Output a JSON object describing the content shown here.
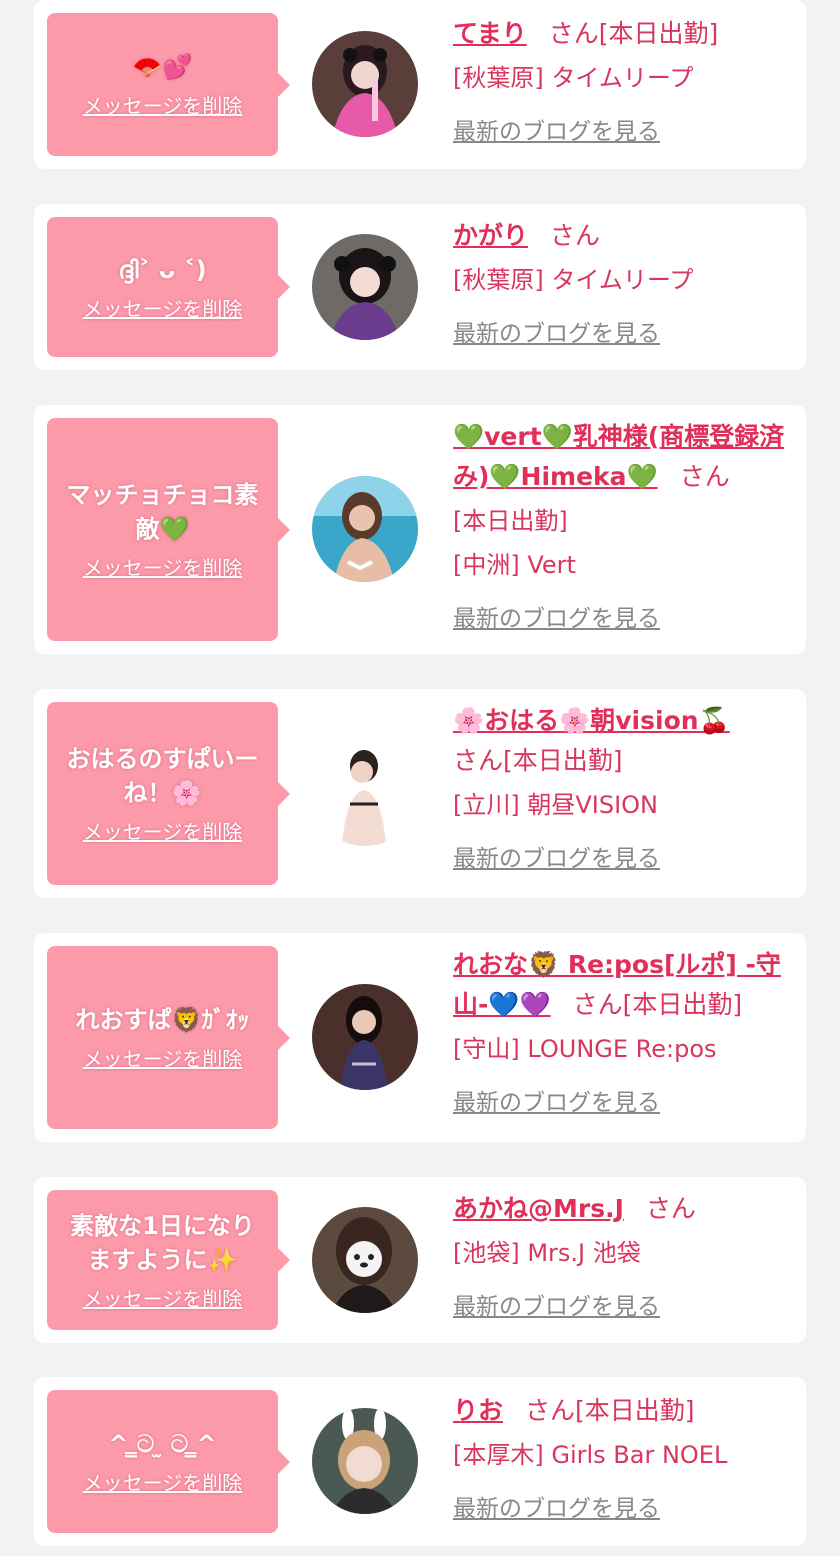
{
  "colors": {
    "background": "#f2f2f2",
    "card": "#ffffff",
    "bubble": "#fd9aaa",
    "accent": "#e0305a",
    "muted": "#888888"
  },
  "common": {
    "delete_label": "メッセージを削除",
    "san_label": "さん",
    "blog_label": "最新のブログを見る"
  },
  "cards": [
    {
      "message": "🪭💕",
      "name": "てまり",
      "on_duty": "[本日出勤]",
      "shop": "[秋葉原] タイムリープ"
    },
    {
      "message": "ദ്ദി˃ ᴗ ˂)",
      "name": "かがり",
      "on_duty": "",
      "shop": "[秋葉原] タイムリープ"
    },
    {
      "message": "マッチョチョコ素敵💚",
      "name": "💚vert💚乳神様(商標登録済み)💚Himeka💚",
      "on_duty": "[本日出勤]",
      "shop": "[中洲] Vert"
    },
    {
      "message": "おはるのすぱいーね！🌸",
      "name": "🌸おはる🌸朝vision🍒",
      "on_duty": "[本日出勤]",
      "shop": "[立川] 朝昼VISION"
    },
    {
      "message": "れおすぱ🦁ｶﾞｵｯ",
      "name": "れおな🦁 Re:pos[ルポ] -守山-💙💜",
      "on_duty": "[本日出勤]",
      "shop": "[守山] LOUNGE Re:pos"
    },
    {
      "message": "素敵な1日になりますように✨",
      "name": "あかね@Mrs.J",
      "on_duty": "",
      "shop": "[池袋] Mrs.J 池袋"
    },
    {
      "message": "^ ̳ට ̫ ට ̳^",
      "name": "りお",
      "on_duty": "[本日出勤]",
      "shop": "[本厚木] Girls Bar NOEL"
    }
  ]
}
